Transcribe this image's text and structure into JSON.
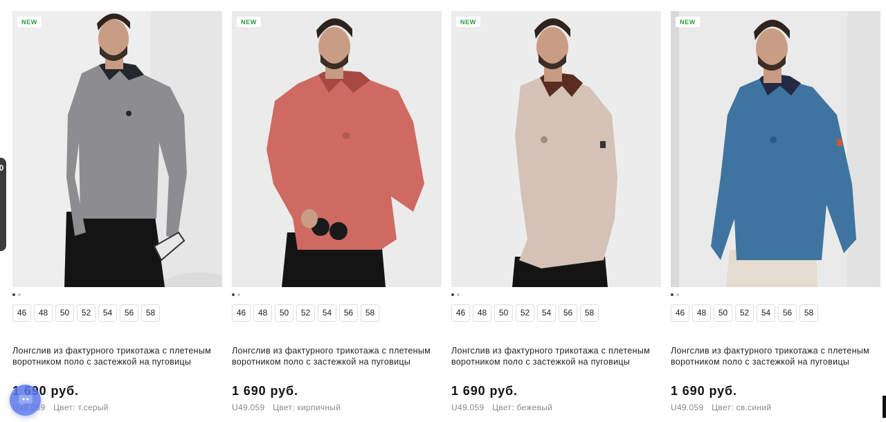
{
  "badge_label": "NEW",
  "products": [
    {
      "title_line1": "Лонгслив из фактурного трикотажа с плетеным",
      "title_line2": "воротником поло с застежкой на пуговицы",
      "price": "1 690 руб.",
      "sku": "U49.059",
      "color": "Цвет: т.серый",
      "sizes": [
        "46",
        "48",
        "50",
        "52",
        "54",
        "56",
        "58"
      ],
      "image_count": 2,
      "shirt_color": "#8d8d8f",
      "collar_color": "#23262b",
      "bg_color": "#eeeeee"
    },
    {
      "title_line1": "Лонгслив из фактурного трикотажа с плетеным",
      "title_line2": "воротником поло с застежкой на пуговицы",
      "price": "1 690 руб.",
      "sku": "U49.059",
      "color": "Цвет: кирпичный",
      "sizes": [
        "46",
        "48",
        "50",
        "52",
        "54",
        "56",
        "58"
      ],
      "image_count": 2,
      "shirt_color": "#cf6a62",
      "collar_color": "#a84842",
      "bg_color": "#ebebeb"
    },
    {
      "title_line1": "Лонгслив из фактурного трикотажа с плетеным",
      "title_line2": "воротником поло с застежкой на пуговицы",
      "price": "1 690 руб.",
      "sku": "U49.059",
      "color": "Цвет: бежевый",
      "sizes": [
        "46",
        "48",
        "50",
        "52",
        "54",
        "56",
        "58"
      ],
      "image_count": 2,
      "shirt_color": "#d3c2b5",
      "collar_color": "#5a2d20",
      "bg_color": "#ececec"
    },
    {
      "title_line1": "Лонгслив из фактурного трикотажа с плетеным",
      "title_line2": "воротником поло с застежкой на пуговицы",
      "price": "1 690 руб.",
      "sku": "U49.059",
      "color": "Цвет: св.синий",
      "sizes": [
        "46",
        "48",
        "50",
        "52",
        "54",
        "56",
        "58"
      ],
      "image_count": 2,
      "shirt_color": "#3f74a0",
      "collar_color": "#232a44",
      "bg_color": "#eaeaea"
    }
  ],
  "icons": {
    "chat": "chat-bubble-icon",
    "edge_tab": "side-panel-tab"
  },
  "accent_colors": {
    "badge_text": "#2e9b3e",
    "chat_button": "#5a78eb"
  }
}
